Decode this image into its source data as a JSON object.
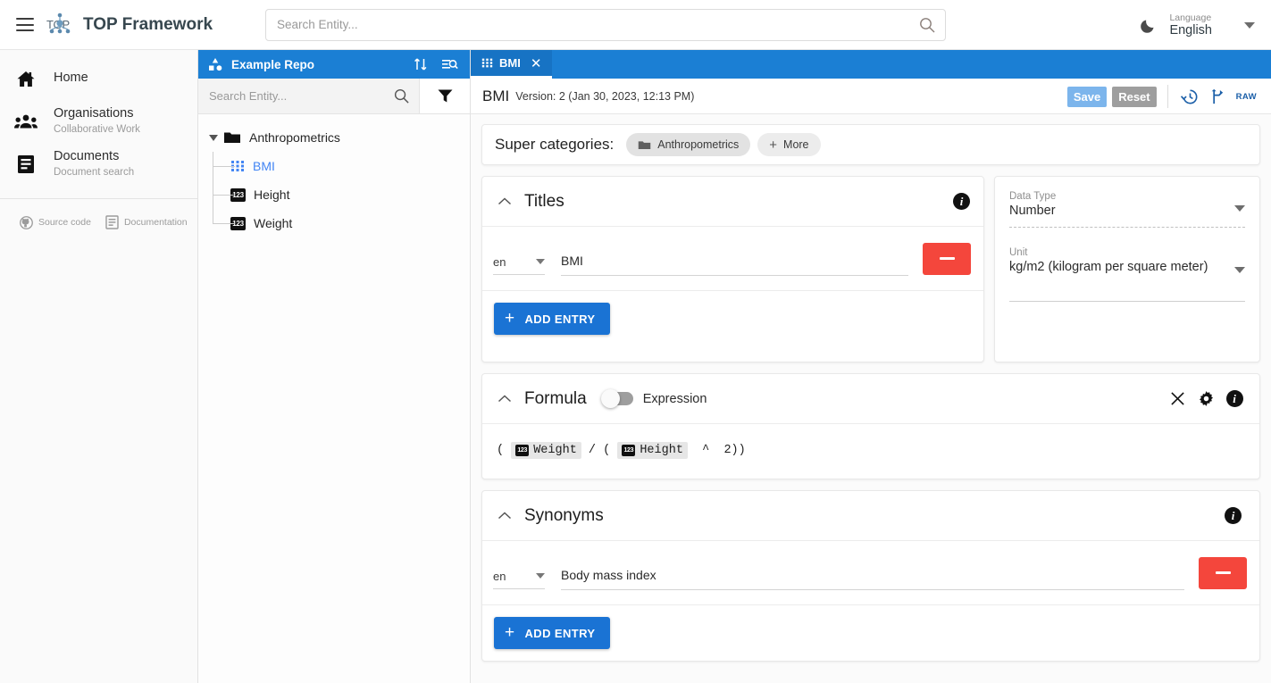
{
  "header": {
    "menu_icon": "hamburger-icon",
    "logo_icon": "top-network-logo",
    "title": "TOP Framework",
    "search": {
      "placeholder": "Search Entity...",
      "value": "",
      "icon": "search-icon"
    },
    "theme_toggle_icon": "moon-icon",
    "language": {
      "label": "Language",
      "value": "English",
      "caret_icon": "chevron-down-icon"
    }
  },
  "sidebar": {
    "items": [
      {
        "label": "Home",
        "sub": "",
        "icon": "home-icon"
      },
      {
        "label": "Organisations",
        "sub": "Collaborative Work",
        "icon": "group-icon"
      },
      {
        "label": "Documents",
        "sub": "Document search",
        "icon": "document-icon"
      }
    ],
    "footer": [
      {
        "label": "Source code",
        "icon": "github-icon"
      },
      {
        "label": "Documentation",
        "icon": "book-icon"
      }
    ]
  },
  "tree_panel": {
    "repo": {
      "name": "Example Repo",
      "icon": "repository-icon"
    },
    "sort_icon": "sort-icon",
    "search_list_icon": "search-list-icon",
    "search": {
      "placeholder": "Search Entity...",
      "value": "",
      "icon": "search-icon"
    },
    "filter_icon": "filter-icon",
    "root": {
      "label": "Anthropometrics",
      "icon": "folder-icon",
      "expanded": true
    },
    "children": [
      {
        "label": "BMI",
        "icon": "grid-icon",
        "active": true
      },
      {
        "label": "Height",
        "icon": "number-icon",
        "active": false
      },
      {
        "label": "Weight",
        "icon": "number-icon",
        "active": false
      }
    ]
  },
  "tabs": [
    {
      "label": "BMI",
      "icon": "grid-icon",
      "close_icon": "close-icon",
      "active": true
    }
  ],
  "version_bar": {
    "entity": "BMI",
    "meta": "Version: 2 (Jan 30, 2023, 12:13 PM)",
    "save_label": "Save",
    "reset_label": "Reset",
    "history_icon": "history-icon",
    "branch_icon": "branch-icon",
    "raw_label": "RAW"
  },
  "super_categories": {
    "label": "Super categories:",
    "chips": [
      {
        "label": "Anthropometrics",
        "icon": "folder-icon"
      },
      {
        "label": "More",
        "icon": "plus-icon"
      }
    ]
  },
  "titles_card": {
    "title": "Titles",
    "collapse_icon": "chevron-up-icon",
    "info_icon": "info-icon",
    "entries": [
      {
        "lang": "en",
        "value": "BMI",
        "remove_icon": "minus-icon"
      }
    ],
    "add_label": "ADD ENTRY"
  },
  "type_panel": {
    "data_type": {
      "label": "Data Type",
      "value": "Number",
      "caret_icon": "chevron-down-icon"
    },
    "unit": {
      "label": "Unit",
      "value": "kg/m2 (kilogram per square meter)",
      "caret_icon": "chevron-down-icon"
    }
  },
  "formula_card": {
    "title": "Formula",
    "collapse_icon": "chevron-up-icon",
    "toggle": {
      "label": "Expression",
      "on": false
    },
    "close_icon": "close-icon",
    "settings_icon": "gear-icon",
    "info_icon": "info-icon",
    "expression": {
      "open": "( ",
      "operand_1": "Weight",
      "operator": " / ",
      "mid": "( ",
      "operand_2": "Height",
      "tail": "  ^  2))"
    }
  },
  "synonyms_card": {
    "title": "Synonyms",
    "collapse_icon": "chevron-up-icon",
    "info_icon": "info-icon",
    "entries": [
      {
        "lang": "en",
        "value": "Body mass index",
        "remove_icon": "minus-icon"
      }
    ],
    "add_label": "ADD ENTRY"
  },
  "colors": {
    "accent_blue": "#1b7fd4",
    "button_blue": "#1a73d4",
    "danger_red": "#f4463c",
    "save_disabled": "#7cb5ec",
    "reset_gray": "#9e9e9e"
  }
}
